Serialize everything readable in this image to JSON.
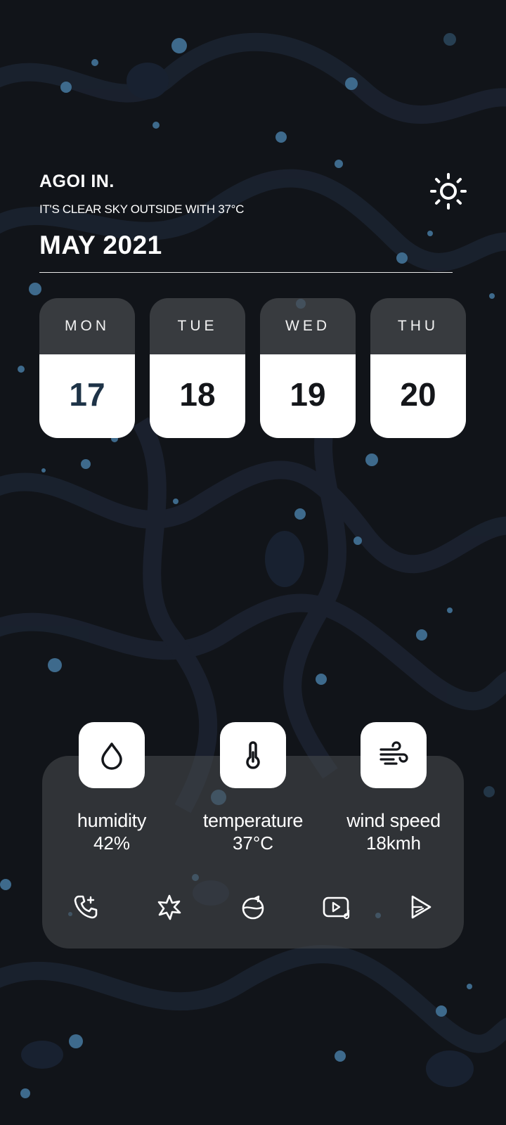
{
  "header": {
    "greeting": "AGOI IN.",
    "subline": "IT'S CLEAR SKY OUTSIDE WITH 37°C",
    "month_year": "MAY  2021",
    "weather_icon": "sun-icon"
  },
  "days": [
    {
      "name": "MON",
      "date": "17"
    },
    {
      "name": "TUE",
      "date": "18"
    },
    {
      "name": "WED",
      "date": "19"
    },
    {
      "name": "THU",
      "date": "20"
    }
  ],
  "stats": {
    "humidity": {
      "label": "humidity",
      "value": "42%",
      "icon": "water-drop-icon"
    },
    "temperature": {
      "label": "temperature",
      "value": "37°C",
      "icon": "thermometer-icon"
    },
    "wind": {
      "label": "wind speed",
      "value": "18kmh",
      "icon": "wind-icon"
    }
  },
  "dock": [
    "phone-icon",
    "flower-icon",
    "compass-icon",
    "video-player-icon",
    "play-store-icon"
  ],
  "colors": {
    "background": "#111419",
    "panel": "#44474b",
    "accent_dots": "#3e6a8c"
  }
}
